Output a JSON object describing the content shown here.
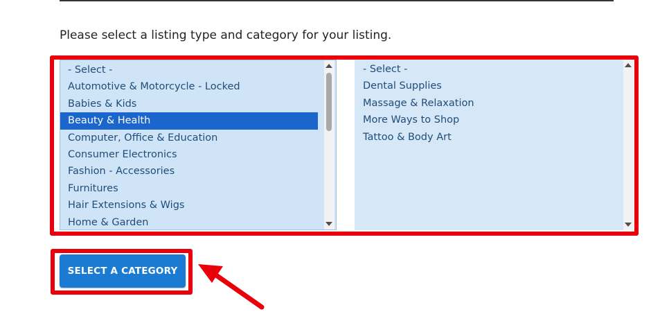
{
  "instructions": "Please select a listing type and category for your listing.",
  "category_list": {
    "options": [
      "- Select -",
      "Automotive & Motorcycle - Locked",
      "Babies & Kids",
      "Beauty & Health",
      "Computer, Office & Education",
      "Consumer Electronics",
      "Fashion - Accessories",
      "Furnitures",
      "Hair Extensions & Wigs",
      "Home & Garden"
    ],
    "selected": "Beauty & Health"
  },
  "subcategory_list": {
    "options": [
      "- Select -",
      "Dental Supplies",
      "Massage & Relaxation",
      "More Ways to Shop",
      "Tattoo & Body Art"
    ]
  },
  "button": {
    "label": "SELECT A CATEGORY"
  },
  "colors": {
    "highlight": "#e8000b",
    "button": "#1b7bd3",
    "selected_option": "#1a66cc",
    "list_text": "#1f4d7a"
  },
  "icons": [
    "arrow-up-icon",
    "arrow-down-icon",
    "annotation-arrow-icon"
  ]
}
